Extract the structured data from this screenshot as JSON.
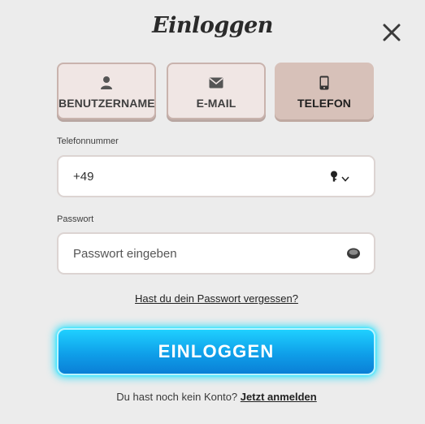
{
  "modal": {
    "title": "Einloggen",
    "close_icon": "close-icon"
  },
  "tabs": [
    {
      "label": "BENUTZERNAME",
      "icon": "user-icon",
      "active": false
    },
    {
      "label": "E-MAIL",
      "icon": "envelope-icon",
      "active": false
    },
    {
      "label": "TELEFON",
      "icon": "mobile-phone-icon",
      "active": true
    }
  ],
  "phone": {
    "label": "Telefonnummer",
    "value": "+49",
    "country_icon": "country-flag-icon",
    "dropdown_icon": "chevron-down-icon"
  },
  "password": {
    "label": "Passwort",
    "placeholder": "Passwort eingeben",
    "toggle_icon": "eye-icon"
  },
  "forgot_link": "Hast du dein Passwort vergessen?",
  "login_button": "EINLOGGEN",
  "signup": {
    "text": "Du hast noch kein Konto?",
    "link": "Jetzt anmelden"
  },
  "colors": {
    "background": "#ececec",
    "tab_active": "#d7c1b9",
    "tab_inactive": "#f0e6e4",
    "button_primary": "#0f9fe9",
    "button_glow": "#00dcff"
  }
}
